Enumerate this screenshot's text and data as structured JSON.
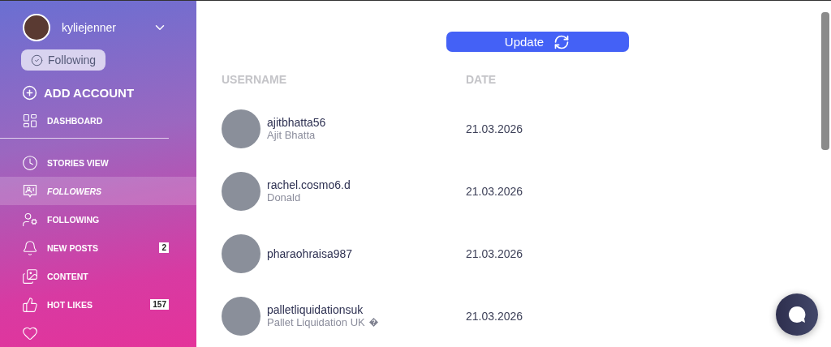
{
  "account": {
    "username": "kyliejenner",
    "status_button": "Following"
  },
  "add_account": "ADD ACCOUNT",
  "nav": [
    {
      "kind": "dashboard",
      "label": "DASHBOARD",
      "selected": false
    },
    {
      "kind": "stories",
      "label": "STORIES VIEW",
      "selected": false
    },
    {
      "kind": "followers",
      "label": "FOLLOWERS",
      "selected": true
    },
    {
      "kind": "following",
      "label": "FOLLOWING",
      "selected": false
    },
    {
      "kind": "posts",
      "label": "NEW POSTS",
      "badge": "2",
      "selected": false
    },
    {
      "kind": "content",
      "label": "CONTENT",
      "selected": false
    },
    {
      "kind": "hotlikes",
      "label": "HOT LIKES",
      "badge": "157",
      "selected": false
    },
    {
      "kind": "likes",
      "selected": false
    }
  ],
  "update_button": "Update",
  "table": {
    "columns": [
      "USERNAME",
      "DATE"
    ],
    "rows": [
      {
        "username": "ajitbhatta56",
        "full_name": "Ajit Bhatta",
        "date": "21.03.2026"
      },
      {
        "username": "rachel.cosmo6.d",
        "full_name": "Donald",
        "date": "21.03.2026"
      },
      {
        "username": "pharaohraisa987",
        "date": "21.03.2026"
      },
      {
        "username": "palletliquidationsuk",
        "full_name": "Pallet Liquidation UK",
        "unknown_glyph": true,
        "date": "21.03.2026"
      }
    ]
  }
}
